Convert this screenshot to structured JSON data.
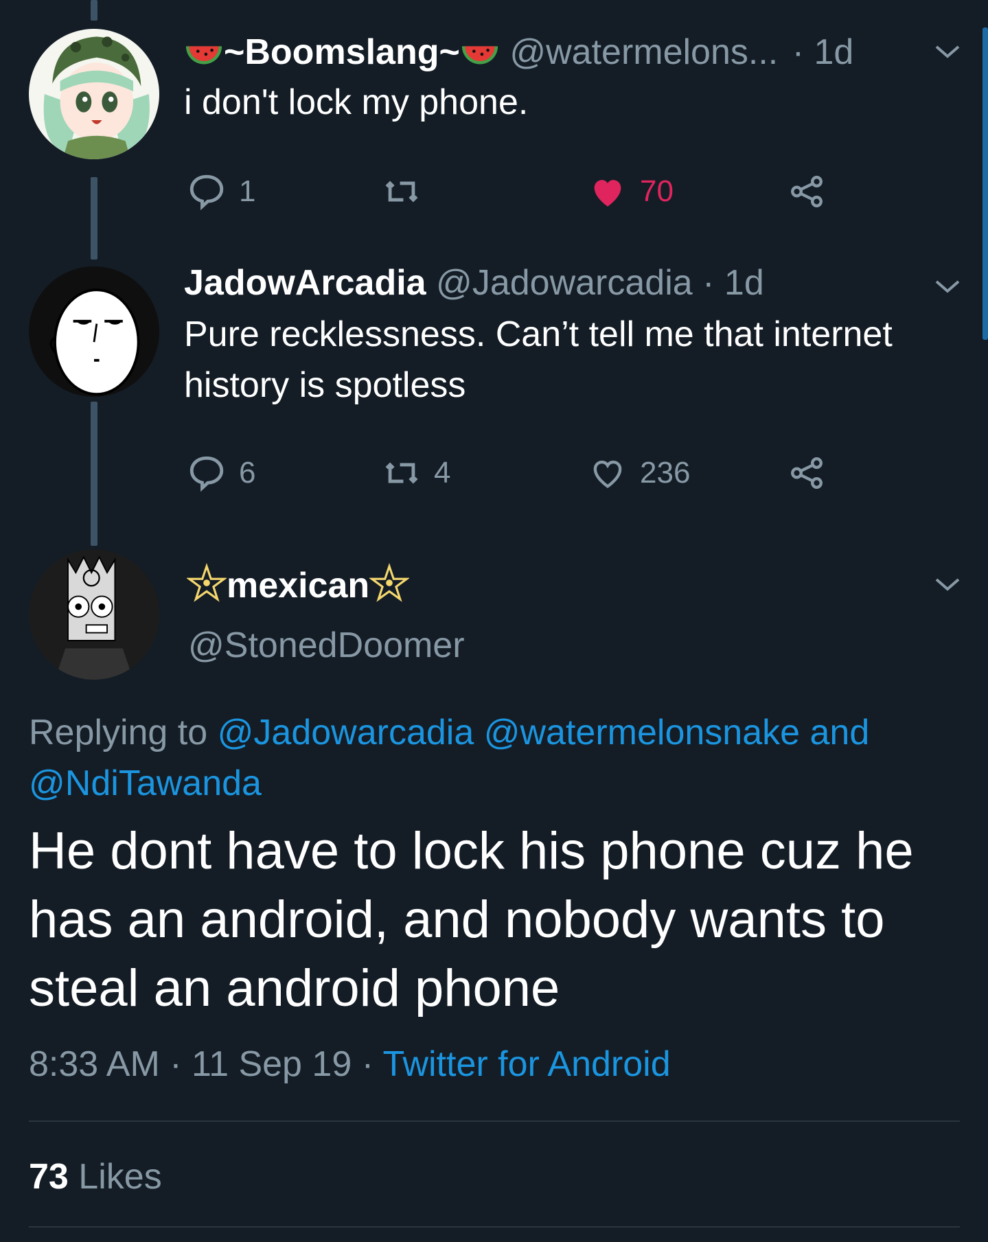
{
  "tweet1": {
    "display_name": "~Boomslang~",
    "handle": "@watermelons...",
    "time": "· 1d",
    "text": "i don't lock my phone.",
    "replies": "1",
    "retweets": "",
    "likes": "70",
    "liked": true
  },
  "tweet2": {
    "display_name": "JadowArcadia",
    "handle": "@Jadowarcadia",
    "time": "· 1d",
    "text": "Pure recklessness. Can’t tell me that internet history is spotless",
    "replies": "6",
    "retweets": "4",
    "likes": "236"
  },
  "tweet3": {
    "display_name": "mexican",
    "handle": "@StonedDoomer",
    "replying_prefix": "Replying to",
    "reply_handle_1": "@Jadowarcadia",
    "reply_handle_2": "@watermelonsnake",
    "reply_and": "and",
    "reply_handle_3": "@NdiTawanda",
    "text": "He dont have to lock his phone cuz he has an android, and nobody wants to steal an android phone",
    "time": "8:33 AM",
    "date": "11 Sep 19",
    "client": "Twitter for Android",
    "likes_count": "73",
    "likes_label": "Likes"
  },
  "colors": {
    "background": "#141d26",
    "muted": "#8899a6",
    "link": "#1b95e0",
    "like": "#e0245e",
    "thread_line": "#3d5466"
  },
  "icons": [
    "reply-icon",
    "retweet-icon",
    "like-icon",
    "share-icon",
    "chevron-down-icon",
    "watermelon-icon",
    "pentagram-icon"
  ]
}
